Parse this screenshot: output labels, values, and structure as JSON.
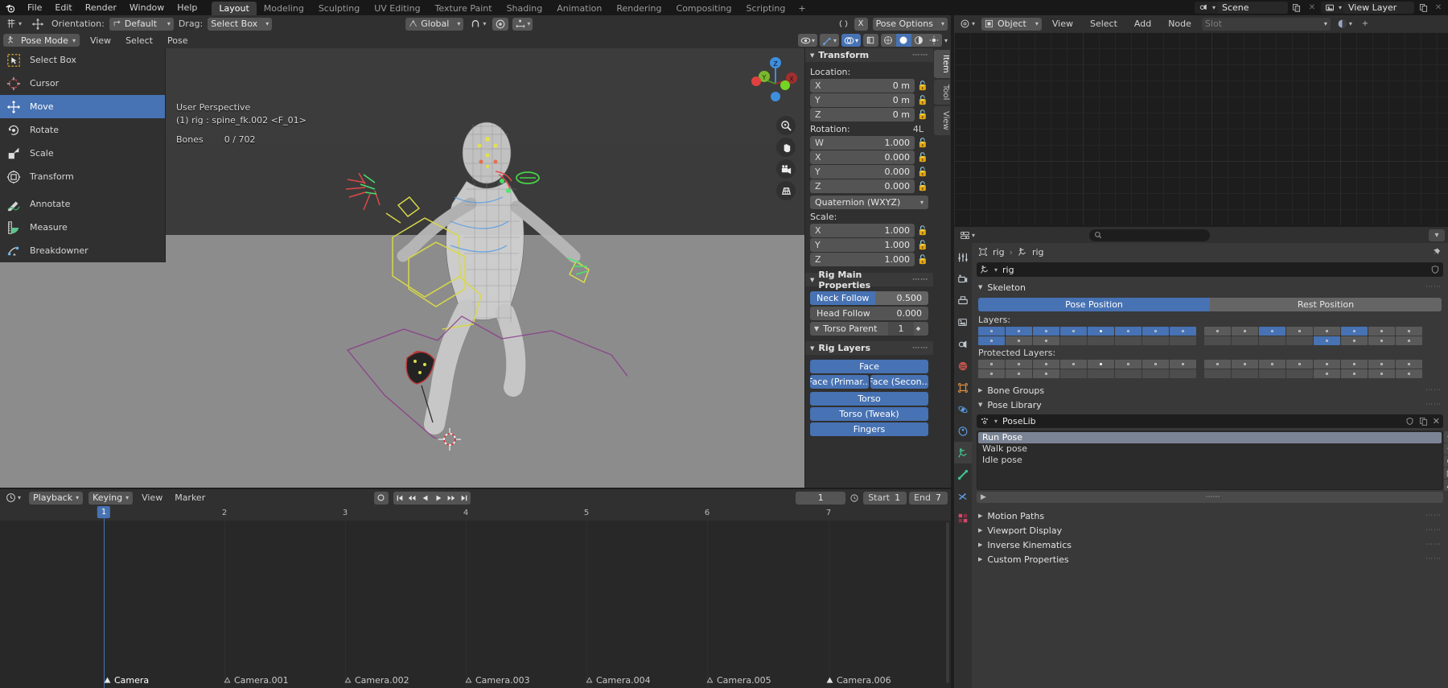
{
  "topbar": {
    "logo_icon": "blender-logo-icon",
    "menus": [
      "File",
      "Edit",
      "Render",
      "Window",
      "Help"
    ],
    "workspace_tabs": [
      {
        "label": "Layout",
        "active": true
      },
      {
        "label": "Modeling",
        "active": false
      },
      {
        "label": "Sculpting",
        "active": false
      },
      {
        "label": "UV Editing",
        "active": false
      },
      {
        "label": "Texture Paint",
        "active": false
      },
      {
        "label": "Shading",
        "active": false
      },
      {
        "label": "Animation",
        "active": false
      },
      {
        "label": "Rendering",
        "active": false
      },
      {
        "label": "Compositing",
        "active": false
      },
      {
        "label": "Scripting",
        "active": false
      },
      {
        "label": "+",
        "active": false
      }
    ],
    "scene_name": "Scene",
    "view_layer_name": "View Layer",
    "scene_icon": "scene-icon",
    "view_layer_icon": "view-layer-icon",
    "new_copy_icon": "duplicate-icon",
    "close_icon": "x-icon"
  },
  "tool_settings": {
    "tool_icon": "active-tool-icon",
    "move_icon": "move-gizmo-icon",
    "orientation_label": "Orientation:",
    "orientation_value": "Default",
    "drag_label": "Drag:",
    "drag_value": "Select Box",
    "transform_space": "Global",
    "snap_icon": "magnet-icon",
    "proportional_icon": "proportional-edit-icon",
    "proportional_falloff_icon": "falloff-curve-icon"
  },
  "node_header": {
    "editor_type_icon": "node-editor-icon",
    "shader_icon": "shading-icon",
    "object_label": "Object",
    "menus": [
      "View",
      "Select",
      "Add",
      "Node"
    ],
    "slot_placeholder": "Slot",
    "material_icon": "material-icon",
    "plus_icon": "plus-icon"
  },
  "viewport_header": {
    "mode": "Pose Mode",
    "menus": [
      "View",
      "Select",
      "Pose"
    ],
    "pose_options_label": "Pose Options",
    "pose_options_icon": "pose-options-icon",
    "x_mirror_icon": "x-axis-mirror-icon",
    "visibility_icon": "object-visibility-icon",
    "gizmo_icon": "gizmo-icon",
    "overlays_icon": "overlays-icon",
    "xray_icon": "x-ray-icon",
    "shading_wireframe_icon": "shading-wireframe-icon",
    "shading_solid_icon": "shading-solid-icon",
    "shading_material_icon": "shading-material-icon",
    "shading_rendered_icon": "shading-rendered-icon"
  },
  "toolbar": {
    "items": [
      {
        "label": "Select Box",
        "icon": "select-box-icon",
        "active": false
      },
      {
        "label": "Cursor",
        "icon": "cursor-icon",
        "active": false
      },
      {
        "label": "Move",
        "icon": "move-icon",
        "active": true
      },
      {
        "label": "Rotate",
        "icon": "rotate-icon",
        "active": false
      },
      {
        "label": "Scale",
        "icon": "scale-icon",
        "active": false
      },
      {
        "label": "Transform",
        "icon": "transform-icon",
        "active": false
      },
      {
        "label": "Annotate",
        "icon": "annotate-icon",
        "active": false
      },
      {
        "label": "Measure",
        "icon": "measure-icon",
        "active": false
      },
      {
        "label": "Breakdowner",
        "icon": "breakdowner-icon",
        "active": false
      }
    ]
  },
  "viewport": {
    "perspective_text": "User Perspective",
    "scene_info": "(1) rig : spine_fk.002 <F_01>",
    "bones_label": "Bones",
    "bones_count": "0 / 702",
    "gizmo_axes": [
      "X",
      "Y",
      "Z"
    ],
    "nav_buttons": [
      "zoom-icon",
      "pan-hand-icon",
      "camera-view-icon",
      "perspective-toggle-icon"
    ]
  },
  "n_panel": {
    "tabs": [
      "Item",
      "Tool",
      "View"
    ],
    "active_tab": "Item",
    "transform": {
      "title": "Transform",
      "location_label": "Location:",
      "location": [
        {
          "axis": "X",
          "value": "0 m"
        },
        {
          "axis": "Y",
          "value": "0 m"
        },
        {
          "axis": "Z",
          "value": "0 m"
        }
      ],
      "rotation_label": "Rotation:",
      "rotation_mode_badge": "4L",
      "rotation": [
        {
          "axis": "W",
          "value": "1.000"
        },
        {
          "axis": "X",
          "value": "0.000"
        },
        {
          "axis": "Y",
          "value": "0.000"
        },
        {
          "axis": "Z",
          "value": "0.000"
        }
      ],
      "rotation_mode": "Quaternion (WXYZ)",
      "scale_label": "Scale:",
      "scale": [
        {
          "axis": "X",
          "value": "1.000"
        },
        {
          "axis": "Y",
          "value": "1.000"
        },
        {
          "axis": "Z",
          "value": "1.000"
        }
      ]
    },
    "rig_main_properties": {
      "title": "Rig Main Properties",
      "neck_follow_label": "Neck Follow",
      "neck_follow_value": "0.500",
      "head_follow_label": "Head Follow",
      "head_follow_value": "0.000",
      "torso_parent_label": "Torso Parent",
      "torso_parent_value": "1"
    },
    "rig_layers": {
      "title": "Rig Layers",
      "rows": [
        [
          "Face"
        ],
        [
          "Face (Primar...",
          "Face (Secon..."
        ],
        [
          "Torso"
        ],
        [
          "Torso (Tweak)"
        ],
        [
          "Fingers"
        ]
      ]
    }
  },
  "timeline": {
    "editor_icon": "timeline-editor-icon",
    "playback_label": "Playback",
    "keying_label": "Keying",
    "menus": [
      "View",
      "Marker"
    ],
    "record_icon": "auto-keying-icon",
    "transport_icons": [
      "jump-to-start-icon",
      "prev-keyframe-icon",
      "play-reverse-icon",
      "play-icon",
      "next-keyframe-icon",
      "jump-to-end-icon"
    ],
    "current_frame": "1",
    "start_label": "Start",
    "start_value": "1",
    "end_label": "End",
    "end_value": "7",
    "ruler_ticks": [
      "1",
      "2",
      "3",
      "4",
      "5",
      "6",
      "7"
    ],
    "playhead_frame": "1",
    "markers": [
      {
        "label": "Camera",
        "selected": true
      },
      {
        "label": "Camera.001",
        "selected": false
      },
      {
        "label": "Camera.002",
        "selected": false
      },
      {
        "label": "Camera.003",
        "selected": false
      },
      {
        "label": "Camera.004",
        "selected": false
      },
      {
        "label": "Camera.005",
        "selected": false
      },
      {
        "label": "Camera.006",
        "selected": false
      }
    ]
  },
  "properties": {
    "editor_icon": "properties-editor-icon",
    "search_placeholder": "",
    "search_icon": "search-icon",
    "breadcrumb": [
      "rig",
      "rig"
    ],
    "breadcrumb_object_icon": "object-data-icon",
    "breadcrumb_armature_icon": "armature-icon",
    "pin_icon": "pin-icon",
    "id_name": "rig",
    "id_icon": "armature-data-icon",
    "shield_icon": "fake-user-shield-icon",
    "nav_icons": [
      "tool-icon",
      "render-icon",
      "output-icon",
      "view-layer-icon",
      "scene-icon",
      "world-icon",
      "object-icon",
      "modifier-icon",
      "physics-icon",
      "object-constraint-icon",
      "object-data-icon",
      "bone-icon",
      "bone-constraint-icon",
      "texture-icon"
    ],
    "skeleton": {
      "title": "Skeleton",
      "pose_position_label": "Pose Position",
      "rest_position_label": "Rest Position",
      "pose_position_active": true,
      "layers_label": "Layers:",
      "protected_layers_label": "Protected Layers:",
      "layers_left_row1": [
        "on",
        "on",
        "on",
        "on",
        "on-filled",
        "on",
        "on",
        "on"
      ],
      "layers_left_row2": [
        "on",
        "off",
        "off",
        "empty",
        "empty",
        "empty",
        "empty",
        "empty"
      ],
      "layers_right_row1": [
        "off",
        "off",
        "on",
        "off",
        "off",
        "on",
        "off",
        "off"
      ],
      "layers_right_row2": [
        "empty",
        "empty",
        "empty",
        "empty",
        "on",
        "off",
        "off",
        "off"
      ],
      "protected_left_row1": [
        "off",
        "off",
        "off",
        "off",
        "off-filled",
        "off",
        "off",
        "off"
      ],
      "protected_left_row2": [
        "off",
        "off",
        "off",
        "empty",
        "empty",
        "empty",
        "empty",
        "empty"
      ],
      "protected_right_row1": [
        "off",
        "off",
        "off",
        "off",
        "off",
        "off",
        "off",
        "off"
      ],
      "protected_right_row2": [
        "empty",
        "empty",
        "empty",
        "empty",
        "off",
        "off",
        "off",
        "off"
      ]
    },
    "bone_groups_label": "Bone Groups",
    "pose_library": {
      "title": "Pose Library",
      "datablock_icon": "pose-library-icon",
      "datablock_name": "PoseLib",
      "poses": [
        {
          "label": "Run Pose",
          "selected": true
        },
        {
          "label": "Walk pose",
          "selected": false
        },
        {
          "label": "Idle pose",
          "selected": false
        }
      ],
      "side_buttons": [
        "+",
        "−",
        "zoom-icon",
        "question-icon",
        "up-arrow-icon"
      ]
    },
    "collapsed_sections": [
      "Motion Paths",
      "Viewport Display",
      "Inverse Kinematics",
      "Custom Properties"
    ]
  },
  "colors": {
    "accent_blue": "#4772b3",
    "panel_bg": "#303030",
    "editor_bg": "#393939",
    "dark_bg": "#1d1d1d",
    "field_bg": "#545454"
  }
}
